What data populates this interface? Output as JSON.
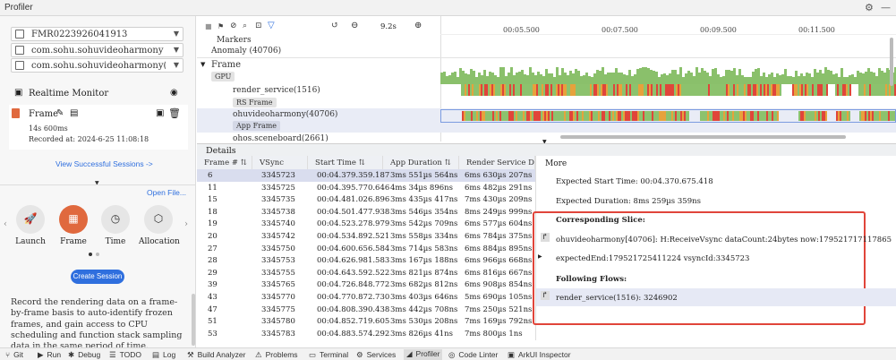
{
  "titlebar": {
    "title": "Profiler"
  },
  "left": {
    "device": "FMR0223926041913",
    "app": "com.sohu.sohuvideoharmony",
    "process": "com.sohu.sohuvideoharmony(40706)",
    "realtime_title": "Realtime Monitor",
    "session": {
      "name": "Frame",
      "duration": "14s 600ms",
      "recorded": "Recorded at: 2024-6-25 11:08:18"
    },
    "view_sessions": "View Successful Sessions ->",
    "open_file": "Open File...",
    "tools": [
      {
        "label": "Launch",
        "icon": "🚀"
      },
      {
        "label": "Frame",
        "icon": "▦"
      },
      {
        "label": "Time",
        "icon": "◷"
      },
      {
        "label": "Allocation",
        "icon": "⬡"
      }
    ],
    "create_session": "Create Session",
    "description": "Record the rendering data on a frame-by-frame basis to auto-identify frozen frames, and gain access to CPU scheduling and function stack sampling data in the same period of time."
  },
  "timeline": {
    "time_display": "9.2s",
    "ticks": [
      "00:05.500",
      "00:07.500",
      "00:09.500",
      "00:11.500"
    ],
    "rows": {
      "markers": "Markers",
      "anomaly": "Anomaly (40706)",
      "frame": "Frame",
      "gpu": "GPU",
      "render_service": "render_service(1516)",
      "rs_frame": "RS Frame",
      "app_proc": "ohuvideoharmony(40706)",
      "app_frame": "App Frame",
      "scenebar": "ohos.sceneboard(2661)"
    }
  },
  "details": {
    "title": "Details",
    "more_title": "More",
    "columns": [
      "Frame #",
      "VSync",
      "Start Time",
      "App Duration",
      "Render Service Durat"
    ],
    "rows": [
      [
        "6",
        "3345723",
        "00:04.379.359.187",
        "3ms 551µs 564ns",
        "6ms 630µs 207ns"
      ],
      [
        "11",
        "3345725",
        "00:04.395.770.646",
        "4ms 34µs 896ns",
        "6ms 482µs 291ns"
      ],
      [
        "15",
        "3345735",
        "00:04.481.026.896",
        "3ms 435µs 417ns",
        "7ms 430µs 209ns"
      ],
      [
        "18",
        "3345738",
        "00:04.501.477.938",
        "3ms 546µs 354ns",
        "8ms 249µs 999ns"
      ],
      [
        "19",
        "3345740",
        "00:04.523.278.979",
        "3ms 542µs 709ns",
        "6ms 577µs 604ns"
      ],
      [
        "20",
        "3345742",
        "00:04.534.892.521",
        "3ms 558µs 334ns",
        "6ms 784µs 375ns"
      ],
      [
        "27",
        "3345750",
        "00:04.600.656.584",
        "3ms 714µs 583ns",
        "6ms 884µs 895ns"
      ],
      [
        "28",
        "3345753",
        "00:04.626.981.583",
        "3ms 167µs 188ns",
        "6ms 966µs 668ns"
      ],
      [
        "29",
        "3345755",
        "00:04.643.592.522",
        "3ms 821µs 874ns",
        "6ms 816µs 667ns"
      ],
      [
        "39",
        "3345765",
        "00:04.726.848.772",
        "3ms 682µs 812ns",
        "6ms 908µs 854ns"
      ],
      [
        "43",
        "3345770",
        "00:04.770.872.730",
        "3ms 403µs 646ns",
        "5ms 690µs 105ns"
      ],
      [
        "47",
        "3345775",
        "00:04.808.390.438",
        "3ms 442µs 708ns",
        "7ms 250µs 521ns"
      ],
      [
        "51",
        "3345780",
        "00:04.852.719.605",
        "3ms 530µs 208ns",
        "7ms 169µs 792ns"
      ],
      [
        "53",
        "3345783",
        "00:04.883.574.292",
        "3ms 826µs 41ns",
        "7ms 800µs 1ns"
      ]
    ],
    "more": {
      "expected_start": "Expected Start Time: 00:04.370.675.418",
      "expected_duration": "Expected Duration: 8ms 259µs 359ns",
      "corresponding_slice": "Corresponding Slice:",
      "slice_detail": "ohuvideoharmony[40706]: H:ReceiveVsync dataCount:24bytes now:179521717117865",
      "expected_end": "expectedEnd:179521725411224 vsyncId:3345723",
      "following_flows": "Following Flows:",
      "flow_detail": "render_service(1516): 3246902"
    }
  },
  "bottombar": {
    "items": [
      {
        "label": "Git",
        "icon": "⑂"
      },
      {
        "label": "Run",
        "icon": "▶"
      },
      {
        "label": "Debug",
        "icon": "✱"
      },
      {
        "label": "TODO",
        "icon": "☰"
      },
      {
        "label": "Log",
        "icon": "▤"
      },
      {
        "label": "Build Analyzer",
        "icon": "⚒"
      },
      {
        "label": "Problems",
        "icon": "⚠"
      },
      {
        "label": "Terminal",
        "icon": "▭"
      },
      {
        "label": "Services",
        "icon": "⚙"
      },
      {
        "label": "Profiler",
        "icon": "◢"
      },
      {
        "label": "Code Linter",
        "icon": "◎"
      },
      {
        "label": "ArkUI Inspector",
        "icon": "▣"
      }
    ]
  },
  "colors": {
    "accent": "#2f6fde",
    "frame_active": "#e0693e",
    "gpu_green": "#8ac06b",
    "highlight_red": "#e0453a"
  }
}
